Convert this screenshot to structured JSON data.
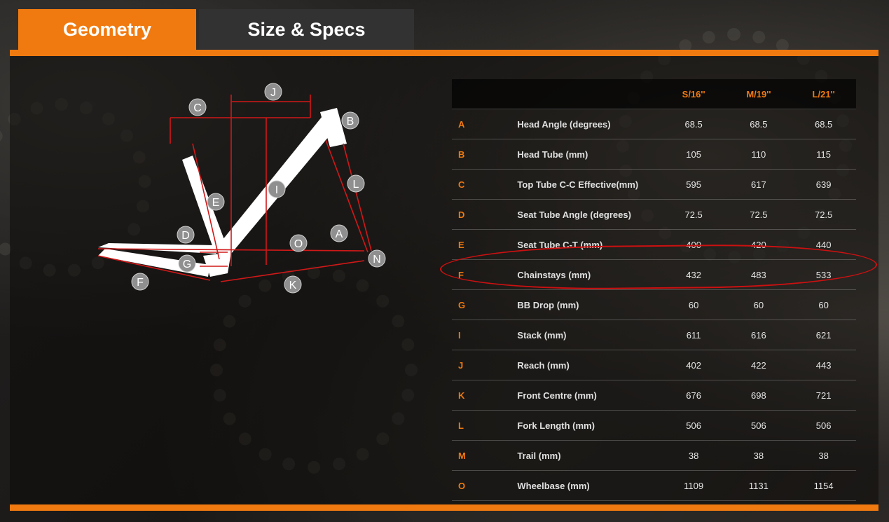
{
  "tabs": [
    {
      "label": "Geometry",
      "active": true
    },
    {
      "label": "Size & Specs",
      "active": false
    }
  ],
  "accent_color": "#f07a10",
  "diagram_labels": [
    "A",
    "B",
    "C",
    "D",
    "E",
    "F",
    "G",
    "I",
    "J",
    "K",
    "L",
    "N",
    "O"
  ],
  "table": {
    "headers": [
      "S/16''",
      "M/19''",
      "L/21''"
    ],
    "rows": [
      {
        "letter": "A",
        "label": "Head Angle (degrees)",
        "values": [
          "68.5",
          "68.5",
          "68.5"
        ]
      },
      {
        "letter": "B",
        "label": "Head Tube (mm)",
        "values": [
          "105",
          "110",
          "115"
        ]
      },
      {
        "letter": "C",
        "label": "Top Tube C-C Effective(mm)",
        "values": [
          "595",
          "617",
          "639"
        ]
      },
      {
        "letter": "D",
        "label": "Seat Tube Angle (degrees)",
        "values": [
          "72.5",
          "72.5",
          "72.5"
        ]
      },
      {
        "letter": "E",
        "label": "Seat Tube C-T (mm)",
        "values": [
          "400",
          "420",
          "440"
        ]
      },
      {
        "letter": "F",
        "label": "Chainstays (mm)",
        "values": [
          "432",
          "483",
          "533"
        ]
      },
      {
        "letter": "G",
        "label": "BB Drop (mm)",
        "values": [
          "60",
          "60",
          "60"
        ]
      },
      {
        "letter": "I",
        "label": "Stack (mm)",
        "values": [
          "611",
          "616",
          "621"
        ]
      },
      {
        "letter": "J",
        "label": "Reach (mm)",
        "values": [
          "402",
          "422",
          "443"
        ]
      },
      {
        "letter": "K",
        "label": "Front Centre (mm)",
        "values": [
          "676",
          "698",
          "721"
        ]
      },
      {
        "letter": "L",
        "label": "Fork Length (mm)",
        "values": [
          "506",
          "506",
          "506"
        ]
      },
      {
        "letter": "M",
        "label": "Trail (mm)",
        "values": [
          "38",
          "38",
          "38"
        ]
      },
      {
        "letter": "O",
        "label": "Wheelbase (mm)",
        "values": [
          "1109",
          "1131",
          "1154"
        ]
      }
    ]
  }
}
